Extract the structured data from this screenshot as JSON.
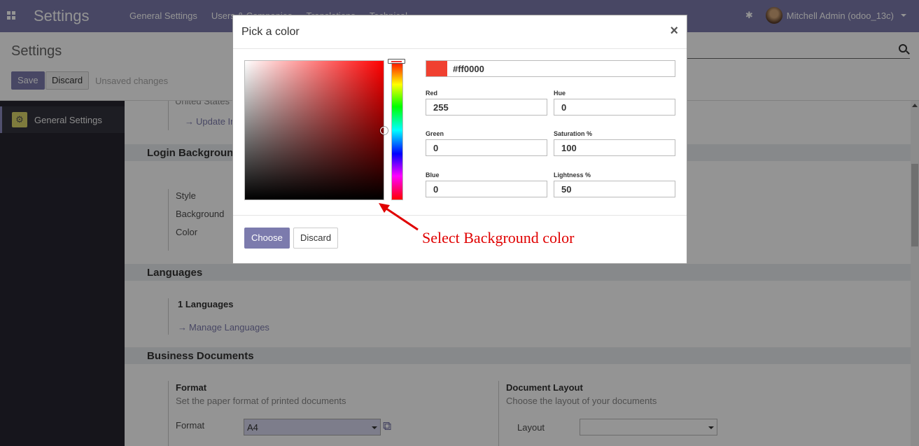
{
  "navbar": {
    "brand": "Settings",
    "menu": [
      "General Settings",
      "Users & Companies",
      "Translations",
      "Technical"
    ],
    "user": "Mitchell Admin (odoo_13c)",
    "colors": {
      "bar": "#7c7bad"
    }
  },
  "control_panel": {
    "title": "Settings",
    "save_label": "Save",
    "discard_label": "Discard",
    "unsaved_label": "Unsaved changes"
  },
  "sidebar": {
    "items": [
      {
        "label": "General Settings",
        "icon": "gear-icon"
      }
    ]
  },
  "content": {
    "partial_country": "United States",
    "update_info_link": "Update Info",
    "login_background": {
      "title": "Login Background",
      "fields": [
        "Style",
        "Background",
        "Color"
      ]
    },
    "languages": {
      "title": "Languages",
      "count": "1 Languages",
      "manage_link": "Manage Languages"
    },
    "business_documents": {
      "title": "Business Documents",
      "format": {
        "heading": "Format",
        "description": "Set the paper format of printed documents",
        "label": "Format",
        "value": "A4"
      },
      "document_layout": {
        "heading": "Document Layout",
        "description": "Choose the layout of your documents",
        "label": "Layout",
        "value": ""
      }
    }
  },
  "color_dialog": {
    "title": "Pick a color",
    "hex": "#ff0000",
    "swatch_color": "#f04030",
    "fields": {
      "red": {
        "label": "Red",
        "value": "255"
      },
      "green": {
        "label": "Green",
        "value": "0"
      },
      "blue": {
        "label": "Blue",
        "value": "0"
      },
      "hue": {
        "label": "Hue",
        "value": "0"
      },
      "saturation": {
        "label": "Saturation %",
        "value": "100"
      },
      "lightness": {
        "label": "Lightness %",
        "value": "50"
      }
    },
    "choose_label": "Choose",
    "discard_label": "Discard"
  },
  "annotation": {
    "text": "Select Background color",
    "color": "#e00000"
  }
}
